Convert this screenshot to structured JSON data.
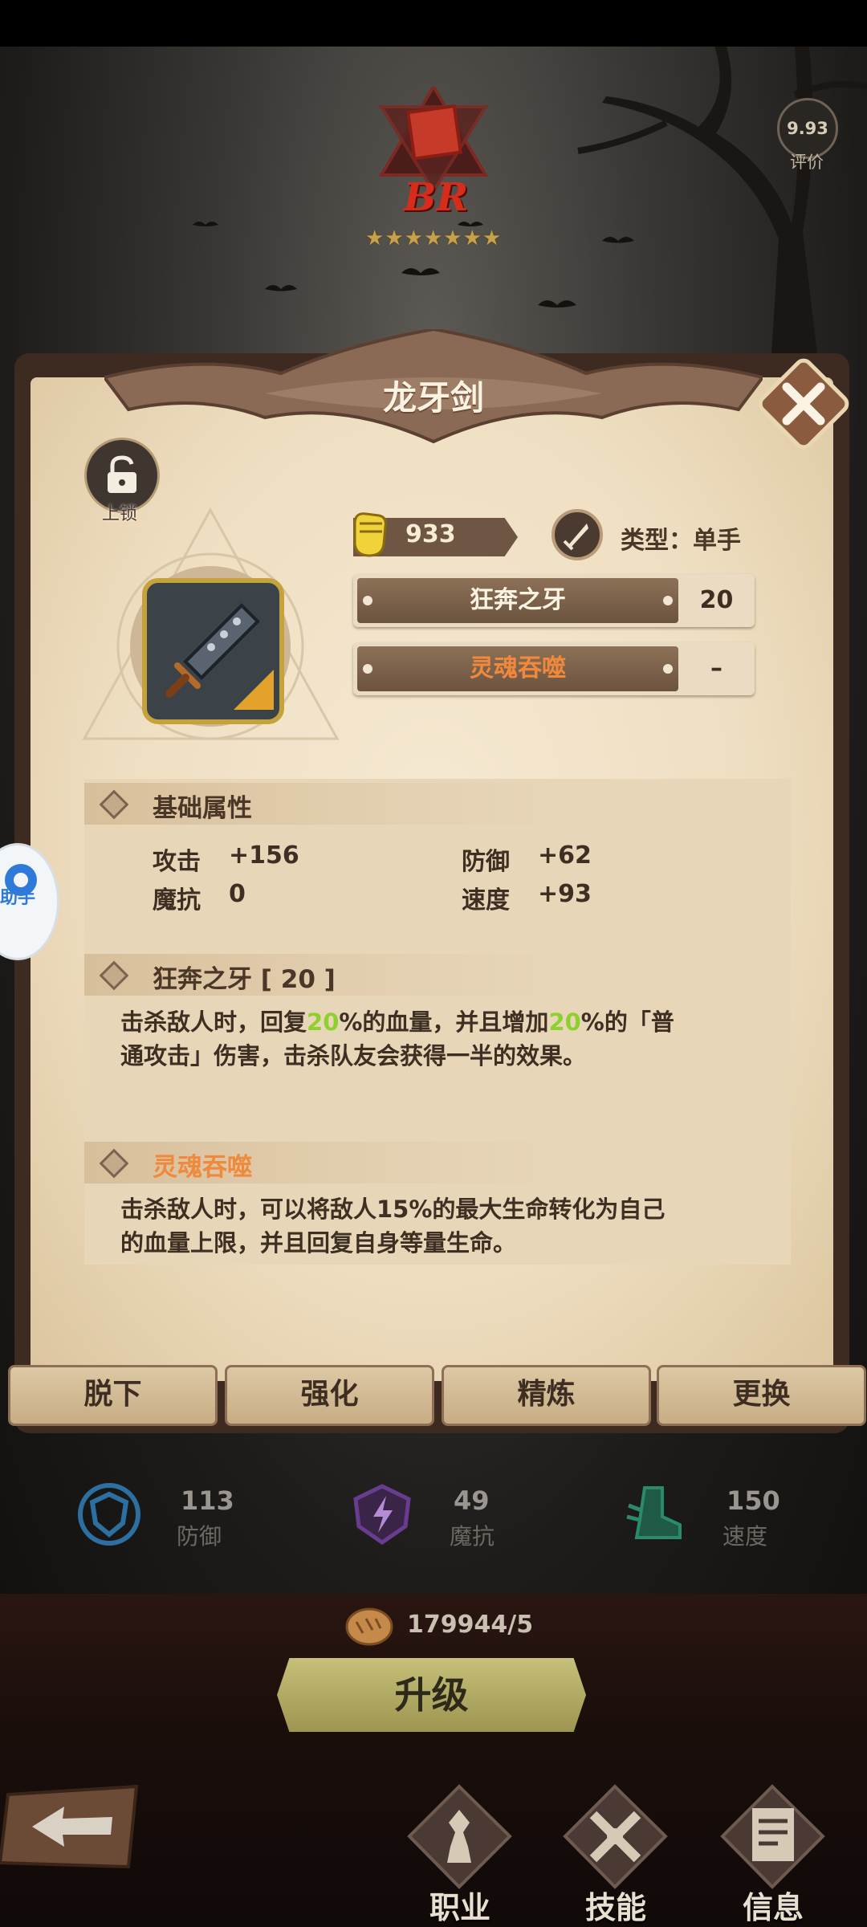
{
  "hero": {
    "rank": "BR",
    "star_count": 7,
    "rating": "9.93",
    "rating_label": "评价"
  },
  "modal": {
    "title": "龙牙剑",
    "lock_label": "上锁",
    "power": "933",
    "type_label": "类型：单手",
    "skills": [
      {
        "name": "狂奔之牙",
        "level": "20"
      },
      {
        "name": "灵魂吞噬",
        "level": "–"
      }
    ],
    "basic_section_title": "基础属性",
    "attributes": [
      {
        "name": "攻击",
        "value": "+156"
      },
      {
        "name": "防御",
        "value": "+62"
      },
      {
        "name": "魔抗",
        "value": "0"
      },
      {
        "name": "速度",
        "value": "+93"
      }
    ],
    "skill1_title": "狂奔之牙 [ 20 ]",
    "skill1_desc": {
      "p1": "击杀敌人时，回复",
      "h1": "20",
      "p2": "%的血量，并且增加",
      "h2": "20",
      "p3": "%的「普",
      "line2": "通攻击」伤害，击杀队友会获得一半的效果。"
    },
    "skill2_title": "灵魂吞噬",
    "skill2_desc": {
      "line1": "击杀敌人时，可以将敌人15%的最大生命转化为自己",
      "line2": "的血量上限，并且回复自身等量生命。"
    },
    "buttons": [
      "脱下",
      "强化",
      "精炼",
      "更换"
    ]
  },
  "stats": [
    {
      "value": "113",
      "label": "防御",
      "icon": "shield-icon",
      "color": "#2c6fa0"
    },
    {
      "value": "49",
      "label": "魔抗",
      "icon": "magic-resist-icon",
      "color": "#6a3c8f"
    },
    {
      "value": "150",
      "label": "速度",
      "icon": "boot-icon",
      "color": "#2b8a6a"
    }
  ],
  "upgrade": {
    "cost": "179944/5",
    "button": "升级"
  },
  "nav": {
    "items": [
      {
        "label": "职业",
        "icon": "class-icon"
      },
      {
        "label": "技能",
        "icon": "skill-icon"
      },
      {
        "label": "信息",
        "icon": "info-icon"
      }
    ]
  },
  "float_widget_text": "助手"
}
